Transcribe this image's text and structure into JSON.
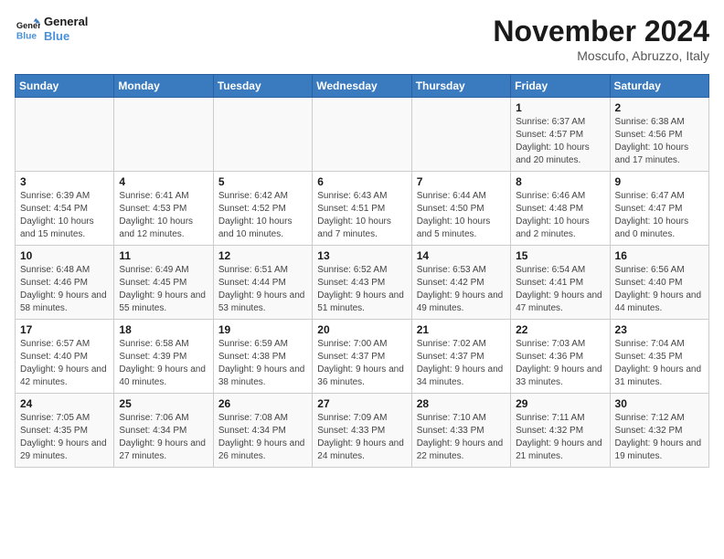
{
  "header": {
    "logo_line1": "General",
    "logo_line2": "Blue",
    "month_title": "November 2024",
    "location": "Moscufo, Abruzzo, Italy"
  },
  "weekdays": [
    "Sunday",
    "Monday",
    "Tuesday",
    "Wednesday",
    "Thursday",
    "Friday",
    "Saturday"
  ],
  "weeks": [
    [
      {
        "day": "",
        "info": ""
      },
      {
        "day": "",
        "info": ""
      },
      {
        "day": "",
        "info": ""
      },
      {
        "day": "",
        "info": ""
      },
      {
        "day": "",
        "info": ""
      },
      {
        "day": "1",
        "info": "Sunrise: 6:37 AM\nSunset: 4:57 PM\nDaylight: 10 hours and 20 minutes."
      },
      {
        "day": "2",
        "info": "Sunrise: 6:38 AM\nSunset: 4:56 PM\nDaylight: 10 hours and 17 minutes."
      }
    ],
    [
      {
        "day": "3",
        "info": "Sunrise: 6:39 AM\nSunset: 4:54 PM\nDaylight: 10 hours and 15 minutes."
      },
      {
        "day": "4",
        "info": "Sunrise: 6:41 AM\nSunset: 4:53 PM\nDaylight: 10 hours and 12 minutes."
      },
      {
        "day": "5",
        "info": "Sunrise: 6:42 AM\nSunset: 4:52 PM\nDaylight: 10 hours and 10 minutes."
      },
      {
        "day": "6",
        "info": "Sunrise: 6:43 AM\nSunset: 4:51 PM\nDaylight: 10 hours and 7 minutes."
      },
      {
        "day": "7",
        "info": "Sunrise: 6:44 AM\nSunset: 4:50 PM\nDaylight: 10 hours and 5 minutes."
      },
      {
        "day": "8",
        "info": "Sunrise: 6:46 AM\nSunset: 4:48 PM\nDaylight: 10 hours and 2 minutes."
      },
      {
        "day": "9",
        "info": "Sunrise: 6:47 AM\nSunset: 4:47 PM\nDaylight: 10 hours and 0 minutes."
      }
    ],
    [
      {
        "day": "10",
        "info": "Sunrise: 6:48 AM\nSunset: 4:46 PM\nDaylight: 9 hours and 58 minutes."
      },
      {
        "day": "11",
        "info": "Sunrise: 6:49 AM\nSunset: 4:45 PM\nDaylight: 9 hours and 55 minutes."
      },
      {
        "day": "12",
        "info": "Sunrise: 6:51 AM\nSunset: 4:44 PM\nDaylight: 9 hours and 53 minutes."
      },
      {
        "day": "13",
        "info": "Sunrise: 6:52 AM\nSunset: 4:43 PM\nDaylight: 9 hours and 51 minutes."
      },
      {
        "day": "14",
        "info": "Sunrise: 6:53 AM\nSunset: 4:42 PM\nDaylight: 9 hours and 49 minutes."
      },
      {
        "day": "15",
        "info": "Sunrise: 6:54 AM\nSunset: 4:41 PM\nDaylight: 9 hours and 47 minutes."
      },
      {
        "day": "16",
        "info": "Sunrise: 6:56 AM\nSunset: 4:40 PM\nDaylight: 9 hours and 44 minutes."
      }
    ],
    [
      {
        "day": "17",
        "info": "Sunrise: 6:57 AM\nSunset: 4:40 PM\nDaylight: 9 hours and 42 minutes."
      },
      {
        "day": "18",
        "info": "Sunrise: 6:58 AM\nSunset: 4:39 PM\nDaylight: 9 hours and 40 minutes."
      },
      {
        "day": "19",
        "info": "Sunrise: 6:59 AM\nSunset: 4:38 PM\nDaylight: 9 hours and 38 minutes."
      },
      {
        "day": "20",
        "info": "Sunrise: 7:00 AM\nSunset: 4:37 PM\nDaylight: 9 hours and 36 minutes."
      },
      {
        "day": "21",
        "info": "Sunrise: 7:02 AM\nSunset: 4:37 PM\nDaylight: 9 hours and 34 minutes."
      },
      {
        "day": "22",
        "info": "Sunrise: 7:03 AM\nSunset: 4:36 PM\nDaylight: 9 hours and 33 minutes."
      },
      {
        "day": "23",
        "info": "Sunrise: 7:04 AM\nSunset: 4:35 PM\nDaylight: 9 hours and 31 minutes."
      }
    ],
    [
      {
        "day": "24",
        "info": "Sunrise: 7:05 AM\nSunset: 4:35 PM\nDaylight: 9 hours and 29 minutes."
      },
      {
        "day": "25",
        "info": "Sunrise: 7:06 AM\nSunset: 4:34 PM\nDaylight: 9 hours and 27 minutes."
      },
      {
        "day": "26",
        "info": "Sunrise: 7:08 AM\nSunset: 4:34 PM\nDaylight: 9 hours and 26 minutes."
      },
      {
        "day": "27",
        "info": "Sunrise: 7:09 AM\nSunset: 4:33 PM\nDaylight: 9 hours and 24 minutes."
      },
      {
        "day": "28",
        "info": "Sunrise: 7:10 AM\nSunset: 4:33 PM\nDaylight: 9 hours and 22 minutes."
      },
      {
        "day": "29",
        "info": "Sunrise: 7:11 AM\nSunset: 4:32 PM\nDaylight: 9 hours and 21 minutes."
      },
      {
        "day": "30",
        "info": "Sunrise: 7:12 AM\nSunset: 4:32 PM\nDaylight: 9 hours and 19 minutes."
      }
    ]
  ]
}
